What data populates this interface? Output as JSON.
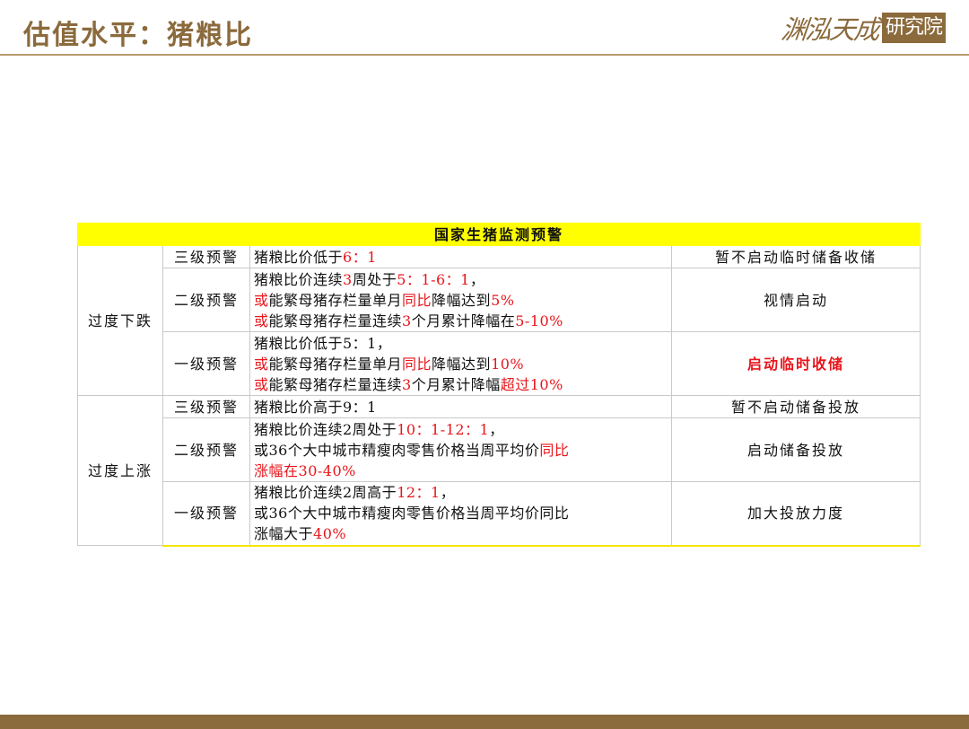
{
  "page": {
    "title": "估值水平：猪粮比",
    "logo_script": "渊泓天成",
    "logo_box": "研究院"
  },
  "table": {
    "header": "国家生猪监测预警",
    "groups": [
      {
        "label": "过度下跌",
        "rows": [
          {
            "level": "三级预警",
            "lines": [
              [
                {
                  "t": "猪粮比价低于"
                },
                {
                  "t": "6：1",
                  "red": true
                }
              ]
            ],
            "action": "暂不启动临时储备收储",
            "action_strong": false
          },
          {
            "level": "二级预警",
            "lines": [
              [
                {
                  "t": "猪粮比价连续"
                },
                {
                  "t": "3",
                  "red": true
                },
                {
                  "t": "周处于"
                },
                {
                  "t": "5：1-6：1",
                  "red": true
                },
                {
                  "t": "，"
                }
              ],
              [
                {
                  "t": "或",
                  "red": true
                },
                {
                  "t": "能繁母猪存栏量单月"
                },
                {
                  "t": "同比",
                  "red": true
                },
                {
                  "t": "降幅达到"
                },
                {
                  "t": "5%",
                  "red": true
                }
              ],
              [
                {
                  "t": "或",
                  "red": true
                },
                {
                  "t": "能繁母猪存栏量连续"
                },
                {
                  "t": "3",
                  "red": true
                },
                {
                  "t": "个月累计降幅在"
                },
                {
                  "t": "5-10%",
                  "red": true
                }
              ]
            ],
            "action": "视情启动",
            "action_strong": false
          },
          {
            "level": "一级预警",
            "lines": [
              [
                {
                  "t": "猪粮比价低于5：1，"
                }
              ],
              [
                {
                  "t": "或",
                  "red": true
                },
                {
                  "t": "能繁母猪存栏量单月"
                },
                {
                  "t": "同比",
                  "red": true
                },
                {
                  "t": "降幅达到"
                },
                {
                  "t": "10%",
                  "red": true
                }
              ],
              [
                {
                  "t": "或",
                  "red": true
                },
                {
                  "t": "能繁母猪存栏量连续"
                },
                {
                  "t": "3",
                  "red": true
                },
                {
                  "t": "个月累计降幅"
                },
                {
                  "t": "超过",
                  "red": true
                },
                {
                  "t": "10%",
                  "red": true
                }
              ]
            ],
            "action": "启动临时收储",
            "action_strong": true
          }
        ]
      },
      {
        "label": "过度上涨",
        "rows": [
          {
            "level": "三级预警",
            "lines": [
              [
                {
                  "t": "猪粮比价高于9：1"
                }
              ]
            ],
            "action": "暂不启动储备投放",
            "action_strong": false
          },
          {
            "level": "二级预警",
            "lines": [
              [
                {
                  "t": "猪粮比价连续2周处于"
                },
                {
                  "t": "10：1-12：1",
                  "red": true
                },
                {
                  "t": "，"
                }
              ],
              [
                {
                  "t": "或36个大中城市精瘦肉零售价格当周平均价"
                },
                {
                  "t": "同比",
                  "red": true
                }
              ],
              [
                {
                  "t": "涨幅在",
                  "red": true
                },
                {
                  "t": "30-40%",
                  "red": true
                }
              ]
            ],
            "action": "启动储备投放",
            "action_strong": false
          },
          {
            "level": "一级预警",
            "lines": [
              [
                {
                  "t": "猪粮比价连续2周高于"
                },
                {
                  "t": "12：1",
                  "red": true
                },
                {
                  "t": "，"
                }
              ],
              [
                {
                  "t": "或36个大中城市精瘦肉零售价格当周平均价同比"
                }
              ],
              [
                {
                  "t": "涨幅大于"
                },
                {
                  "t": "40%",
                  "red": true
                }
              ]
            ],
            "action": "加大投放力度",
            "action_strong": false
          }
        ]
      }
    ]
  }
}
